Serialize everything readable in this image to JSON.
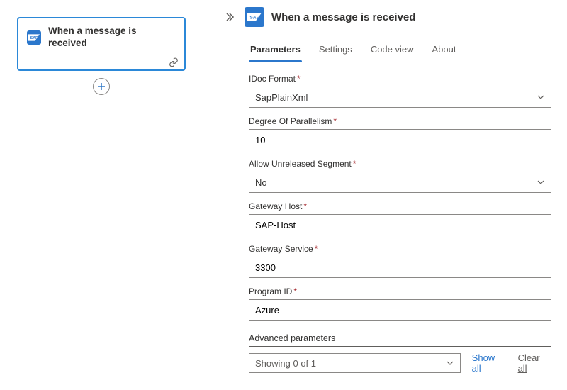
{
  "canvas": {
    "card_title": "When a message is received"
  },
  "panel": {
    "title": "When a message is received",
    "tabs": {
      "parameters": "Parameters",
      "settings": "Settings",
      "code_view": "Code view",
      "about": "About"
    },
    "fields": {
      "idoc_format": {
        "label": "IDoc Format",
        "value": "SapPlainXml"
      },
      "parallelism": {
        "label": "Degree Of Parallelism",
        "value": "10"
      },
      "unreleased": {
        "label": "Allow Unreleased Segment",
        "value": "No"
      },
      "gw_host": {
        "label": "Gateway Host",
        "value": "SAP-Host"
      },
      "gw_service": {
        "label": "Gateway Service",
        "value": "3300"
      },
      "program_id": {
        "label": "Program ID",
        "value": "Azure"
      }
    },
    "advanced": {
      "title": "Advanced parameters",
      "selector": "Showing 0 of 1",
      "show_all": "Show all",
      "clear_all": "Clear all"
    }
  }
}
